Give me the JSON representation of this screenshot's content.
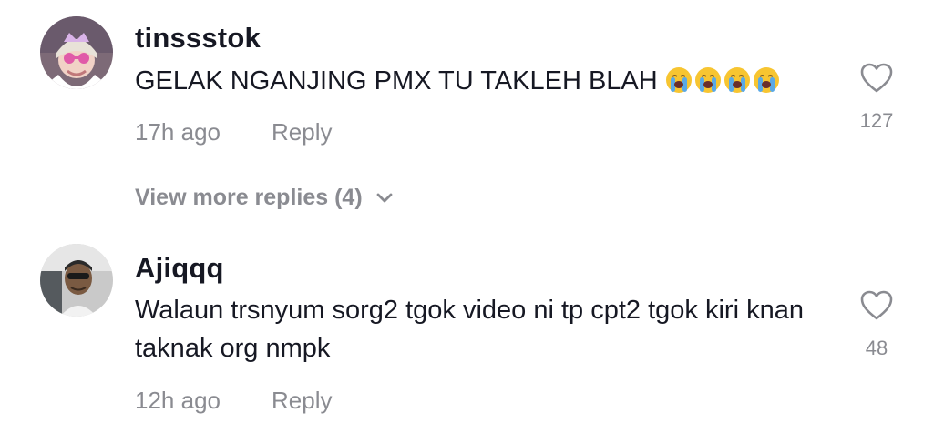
{
  "comments": [
    {
      "username": "tinssstok",
      "text": "GELAK NGANJING PMX TU TAKLEH BLAH",
      "emoji_icons": [
        "loudly-crying-face-icon",
        "loudly-crying-face-icon",
        "loudly-crying-face-icon",
        "loudly-crying-face-icon"
      ],
      "time": "17h ago",
      "reply_label": "Reply",
      "likes": "127",
      "view_more": "View more replies (4)"
    },
    {
      "username": "Ajiqqq",
      "text": "Walaun trsnyum sorg2 tgok video ni tp cpt2 tgok kiri knan taknak org nmpk",
      "time": "12h ago",
      "reply_label": "Reply",
      "likes": "48"
    }
  ],
  "colors": {
    "primary_text": "#161823",
    "secondary_text": "#8a8b91",
    "heart_outline": "#8a8b91",
    "emoji_face": "#f7c531",
    "emoji_tears": "#5aa9e6"
  },
  "icons": {
    "like": "heart-outline-icon",
    "expand": "chevron-down-icon"
  }
}
